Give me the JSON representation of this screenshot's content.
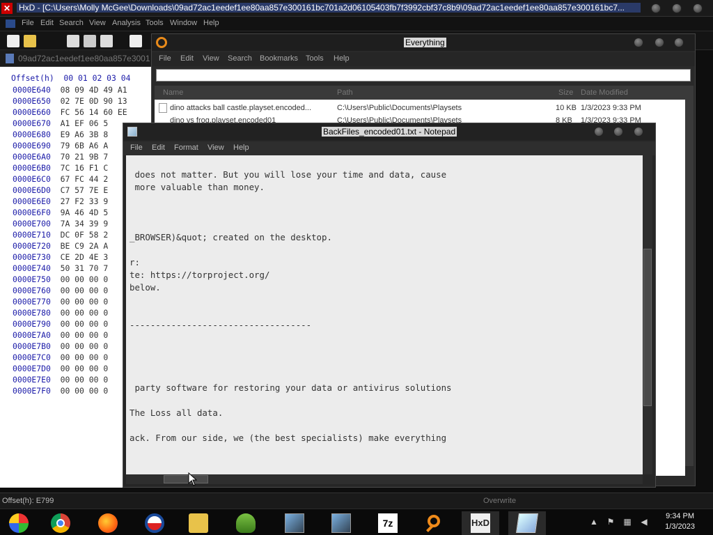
{
  "hxd": {
    "title": "HxD - [C:\\Users\\Molly McGee\\Downloads\\09ad72ac1eedef1ee80aa857e300161bc701a2d06105403fb7f3992cbf37c8b9\\09ad72ac1eedef1ee80aa857e300161bc7...",
    "menu": [
      "File",
      "Edit",
      "Search",
      "View",
      "Analysis",
      "Tools",
      "Window",
      "Help"
    ],
    "tab_label": "09ad72ac1eedef1ee80aa857e3001",
    "hex_header": "Offset(h)  00 01 02 03 04",
    "rows": [
      {
        "offset": "0000E640",
        "bytes": "08 09 4D 49 A1"
      },
      {
        "offset": "0000E650",
        "bytes": "02 7E 0D 90 13"
      },
      {
        "offset": "0000E660",
        "bytes": "FC 56 14 60 EE"
      },
      {
        "offset": "0000E670",
        "bytes": "A1 EF 06 5"
      },
      {
        "offset": "0000E680",
        "bytes": "E9 A6 3B 8"
      },
      {
        "offset": "0000E690",
        "bytes": "79 6B A6 A"
      },
      {
        "offset": "0000E6A0",
        "bytes": "70 21 9B 7"
      },
      {
        "offset": "0000E6B0",
        "bytes": "7C 16 F1 C"
      },
      {
        "offset": "0000E6C0",
        "bytes": "67 FC 44 2"
      },
      {
        "offset": "0000E6D0",
        "bytes": "C7 57 7E E"
      },
      {
        "offset": "0000E6E0",
        "bytes": "27 F2 33 9"
      },
      {
        "offset": "0000E6F0",
        "bytes": "9A 46 4D 5"
      },
      {
        "offset": "0000E700",
        "bytes": "7A 34 39 9"
      },
      {
        "offset": "0000E710",
        "bytes": "DC 0F 58 2"
      },
      {
        "offset": "0000E720",
        "bytes": "BE C9 2A A"
      },
      {
        "offset": "0000E730",
        "bytes": "CE 2D 4E 3"
      },
      {
        "offset": "0000E740",
        "bytes": "50 31 70 7"
      },
      {
        "offset": "0000E750",
        "bytes": "00 00 00 0"
      },
      {
        "offset": "0000E760",
        "bytes": "00 00 00 0"
      },
      {
        "offset": "0000E770",
        "bytes": "00 00 00 0"
      },
      {
        "offset": "0000E780",
        "bytes": "00 00 00 0"
      },
      {
        "offset": "0000E790",
        "bytes": "00 00 00 0"
      },
      {
        "offset": "0000E7A0",
        "bytes": "00 00 00 0"
      },
      {
        "offset": "0000E7B0",
        "bytes": "00 00 00 0"
      },
      {
        "offset": "0000E7C0",
        "bytes": "00 00 00 0"
      },
      {
        "offset": "0000E7D0",
        "bytes": "00 00 00 0"
      },
      {
        "offset": "0000E7E0",
        "bytes": "00 00 00 0"
      },
      {
        "offset": "0000E7F0",
        "bytes": "00 00 00 0"
      }
    ],
    "status_offset": "Offset(h): E799",
    "status_mode": "Overwrite"
  },
  "everything": {
    "title": "Everything",
    "menu": [
      "File",
      "Edit",
      "View",
      "Search",
      "Bookmarks",
      "Tools",
      "Help"
    ],
    "columns": [
      "Name",
      "Path",
      "Size",
      "Date Modified"
    ],
    "rows": [
      {
        "name": "dino attacks ball castle.playset.encoded...",
        "path": "C:\\Users\\Public\\Documents\\Playsets",
        "size": "10 KB",
        "date": "1/3/2023 9:33 PM"
      },
      {
        "name": "dino vs frog.playset.encoded01",
        "path": "C:\\Users\\Public\\Documents\\Playsets",
        "size": "8 KB",
        "date": "1/3/2023 9:33 PM"
      }
    ]
  },
  "notepad": {
    "title": "BackFiles_encoded01.txt - Notepad",
    "menu": [
      "File",
      "Edit",
      "Format",
      "View",
      "Help"
    ],
    "lines": [
      " does not matter. But you will lose your time and data, cause",
      " more valuable than money.",
      "",
      "",
      "",
      "_BROWSER)&quot; created on the desktop.",
      "",
      "r:",
      "te: https://torproject.org/",
      "below.",
      "",
      "",
      "-----------------------------------",
      "",
      "",
      "",
      "",
      " party software for restoring your data or antivirus solutions",
      "",
      "The Loss all data.",
      "",
      "ack. From our side, we (the best specialists) make everything",
      "",
      "",
      "-----------------------------------"
    ]
  },
  "taskbar": {
    "apps": [
      "windows-media-center",
      "chrome",
      "firefox",
      "obama-campaign",
      "file-explorer",
      "network-users",
      "installer-1",
      "installer-2",
      "7zip",
      "everything",
      "hxd",
      "notepad"
    ],
    "time": "9:34 PM",
    "date": "1/3/2023"
  }
}
